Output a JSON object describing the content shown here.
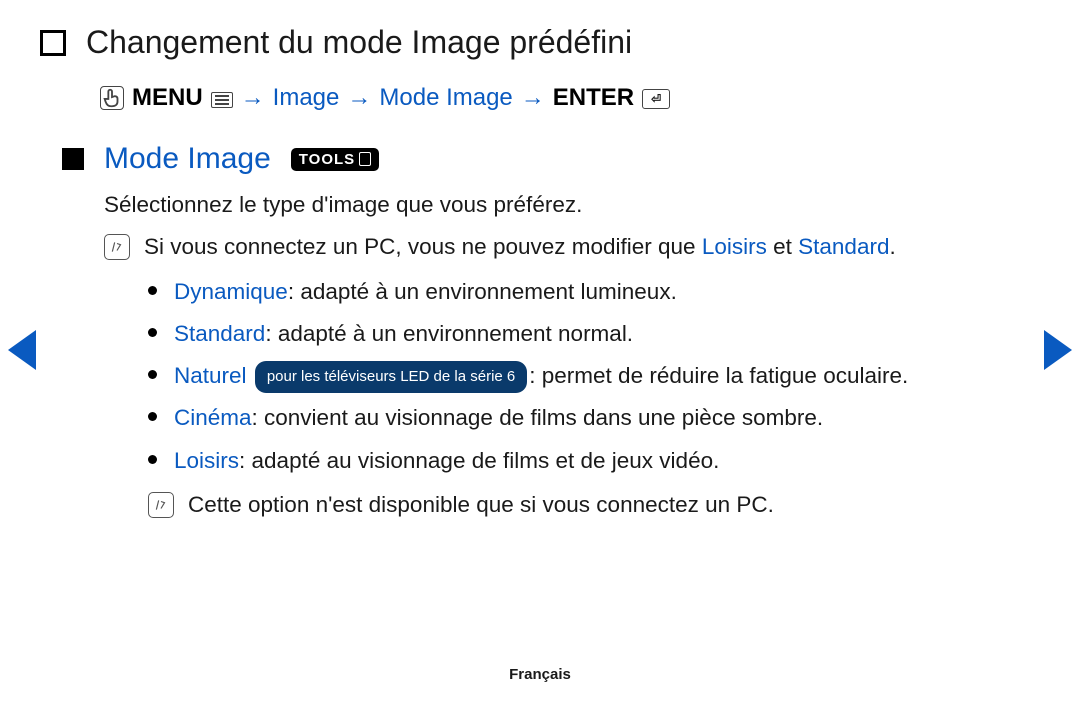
{
  "title": "Changement du mode Image prédéfini",
  "nav": {
    "menu": "MENU",
    "step1": "Image",
    "step2": "Mode Image",
    "enter": "ENTER",
    "arrow": "→"
  },
  "section": {
    "title": "Mode Image",
    "tools_label": "TOOLS"
  },
  "intro": "Sélectionnez le type d'image que vous préférez.",
  "note1_prefix": "Si vous connectez un PC, vous ne pouvez modifier que ",
  "note1_link1": "Loisirs",
  "note1_and": " et ",
  "note1_link2": "Standard",
  "note1_suffix": ".",
  "modes": {
    "dynamique": {
      "label": "Dynamique",
      "desc": ": adapté à un environnement lumineux."
    },
    "standard": {
      "label": "Standard",
      "desc": ": adapté à un environnement normal."
    },
    "naturel": {
      "label": "Naturel",
      "pill": "pour les téléviseurs LED de la série 6",
      "desc": ": permet de réduire la fatigue oculaire."
    },
    "cinema": {
      "label": "Cinéma",
      "desc": ": convient au visionnage de films dans une pièce sombre."
    },
    "loisirs": {
      "label": "Loisirs",
      "desc": ": adapté au visionnage de films et de jeux vidéo."
    }
  },
  "note2": "Cette option n'est disponible que si vous connectez un PC.",
  "footer": "Français"
}
